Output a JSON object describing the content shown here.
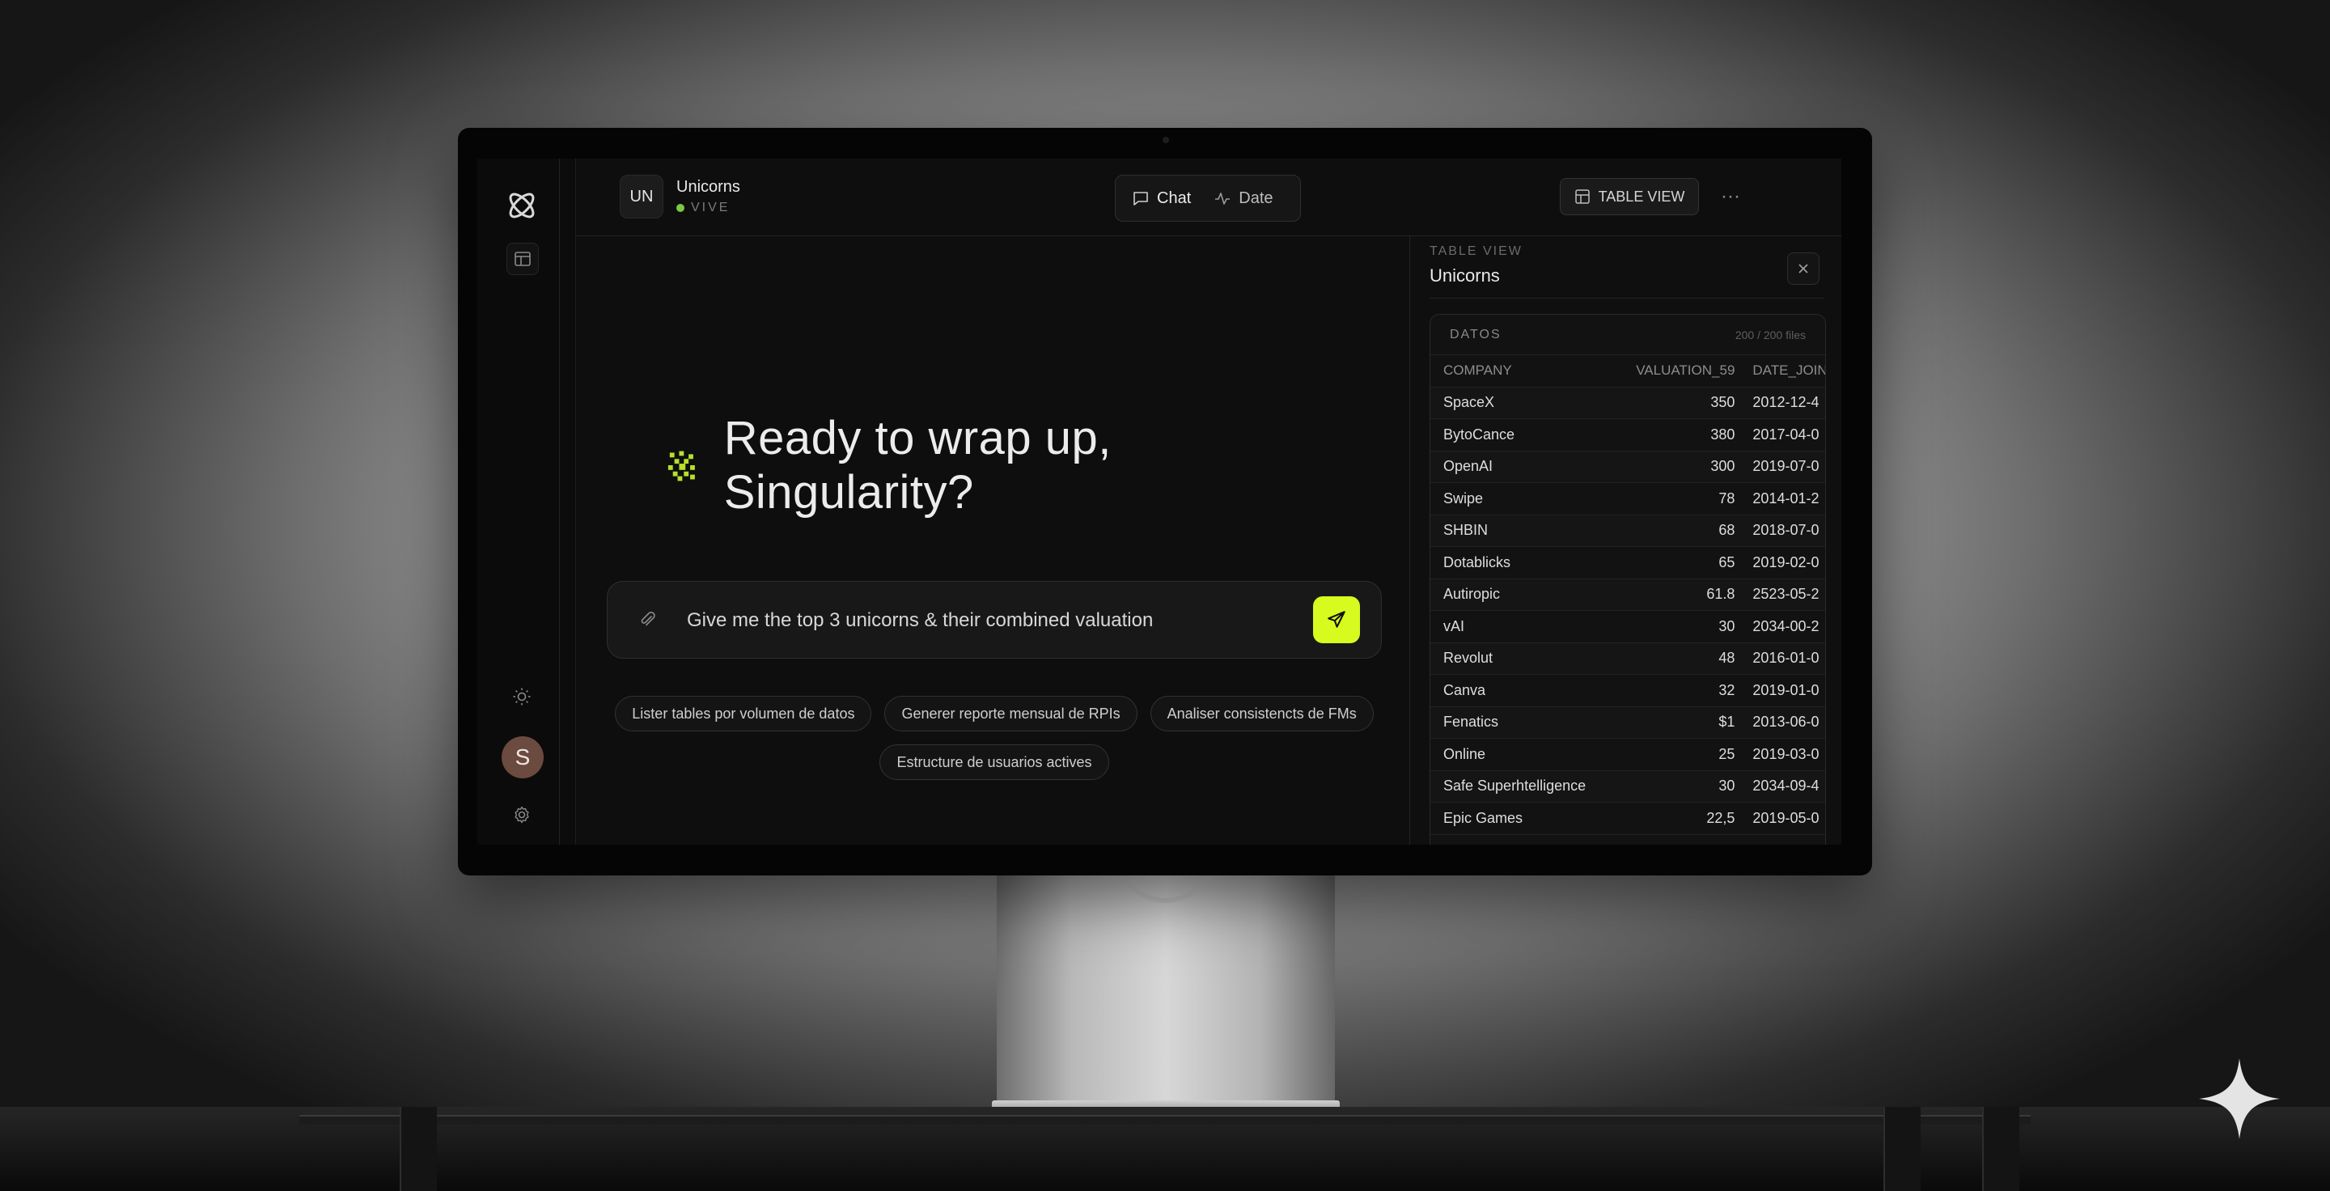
{
  "workspace": {
    "badge": "UN",
    "name": "Unicorns",
    "status": "VIVE",
    "status_color": "#7ac943"
  },
  "mode_toggle": {
    "chat_label": "Chat",
    "data_label": "Date"
  },
  "toolbar": {
    "table_view_label": "TABLE VIEW",
    "more_label": "···"
  },
  "rail": {
    "icons": [
      "atom-logo-icon",
      "table-icon",
      "sun-icon",
      "gear-icon"
    ],
    "avatar_initial": "S"
  },
  "chat": {
    "greeting": "Ready to wrap up, Singularity?",
    "prompt_value": "Give me the top 3 unicorns & their combined valuation",
    "send_color": "#d7fb1e",
    "suggestions": [
      "Lister tables por volumen de datos",
      "Generer reporte mensual de RPIs",
      "Analiser consistencts de FMs",
      "Estructure de usuarios actives"
    ]
  },
  "panel": {
    "eyebrow": "TABLE VIEW",
    "title": "Unicorns",
    "card_label": "DATOS",
    "row_count": "200 / 200 files",
    "columns": [
      "COMPANY",
      "VALUATION_59",
      "DATE_JOIN"
    ],
    "rows": [
      [
        "SpaceX",
        "350",
        "2012-12-4"
      ],
      [
        "BytoCance",
        "380",
        "2017-04-0"
      ],
      [
        "OpenAI",
        "300",
        "2019-07-0"
      ],
      [
        "Swipe",
        "78",
        "2014-01-2"
      ],
      [
        "SHBIN",
        "68",
        "2018-07-0"
      ],
      [
        "Dotablicks",
        "65",
        "2019-02-0"
      ],
      [
        "Autiropic",
        "61.8",
        "2523-05-2"
      ],
      [
        "vAI",
        "30",
        "2034-00-2"
      ],
      [
        "Revolut",
        "48",
        "2016-01-0"
      ],
      [
        "Canva",
        "32",
        "2019-01-0"
      ],
      [
        "Fenatics",
        "$1",
        "2013-06-0"
      ],
      [
        "Online",
        "25",
        "2019-03-0"
      ],
      [
        "Safe Superhtelligence",
        "30",
        "2034-09-4"
      ],
      [
        "Epic Games",
        "22,5",
        "2019-05-0"
      ]
    ]
  }
}
